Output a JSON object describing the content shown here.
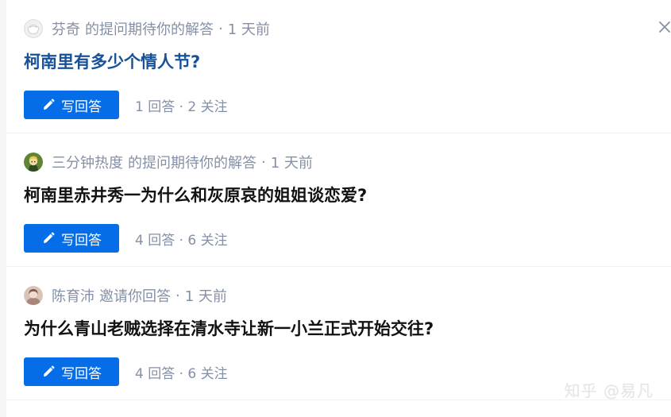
{
  "questions": [
    {
      "author": "芬奇",
      "action": "的提问期待你的解答",
      "time": "1 天前",
      "title": "柯南里有多少个情人节?",
      "button_label": "写回答",
      "stats": "1 回答 · 2 关注",
      "avatar": "avatar-default-icon"
    },
    {
      "author": "三分钟热度",
      "action": "的提问期待你的解答",
      "time": "1 天前",
      "title": "柯南里赤井秀一为什么和灰原哀的姐姐谈恋爱?",
      "button_label": "写回答",
      "stats": "4 回答 · 6 关注",
      "avatar": "avatar-cartoon-icon"
    },
    {
      "author": "陈育沛",
      "action": "邀请你回答",
      "time": "1 天前",
      "title": "为什么青山老贼选择在清水寺让新一小兰正式开始交往?",
      "button_label": "写回答",
      "stats": "4 回答 · 6 关注",
      "avatar": "avatar-photo-icon"
    }
  ],
  "watermark": "知乎 @易凡",
  "colors": {
    "primary": "#056de8",
    "link_title": "#175199",
    "meta": "#8590a6",
    "title": "#121212"
  }
}
